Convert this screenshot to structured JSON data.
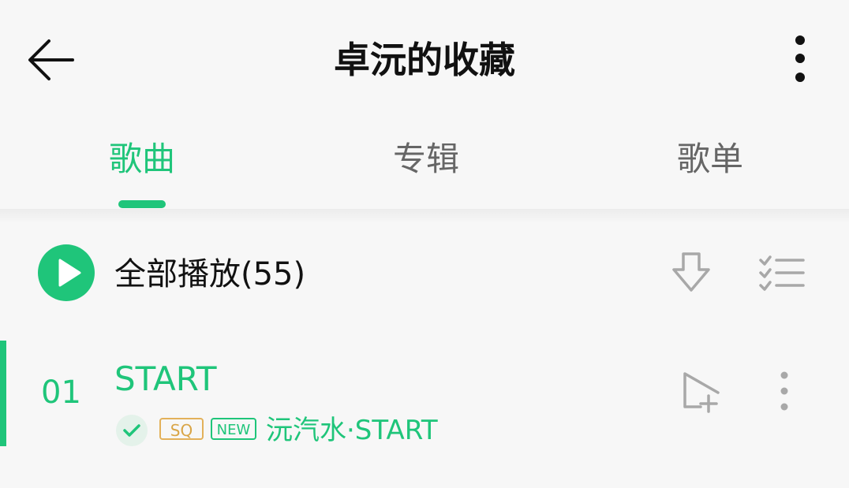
{
  "header": {
    "title": "卓沅的收藏",
    "back_icon": "arrow-left-icon",
    "more_icon": "more-vertical-icon"
  },
  "tabs": [
    {
      "label": "歌曲",
      "active": true
    },
    {
      "label": "专辑",
      "active": false
    },
    {
      "label": "歌单",
      "active": false
    }
  ],
  "play_all": {
    "label": "全部播放(55)",
    "play_icon": "play-icon",
    "download_icon": "download-icon",
    "multi_select_icon": "checklist-icon"
  },
  "songs": [
    {
      "index": "01",
      "title": "START",
      "artist_album": "沅汽水·START",
      "tags": [
        "SQ",
        "NEW"
      ],
      "downloaded": true,
      "playing": true
    }
  ],
  "colors": {
    "accent": "#1fc57a",
    "sq_tag": "#d9a547",
    "title_text": "#111111",
    "inactive_tab": "#666666",
    "background": "#f7f7f7"
  }
}
